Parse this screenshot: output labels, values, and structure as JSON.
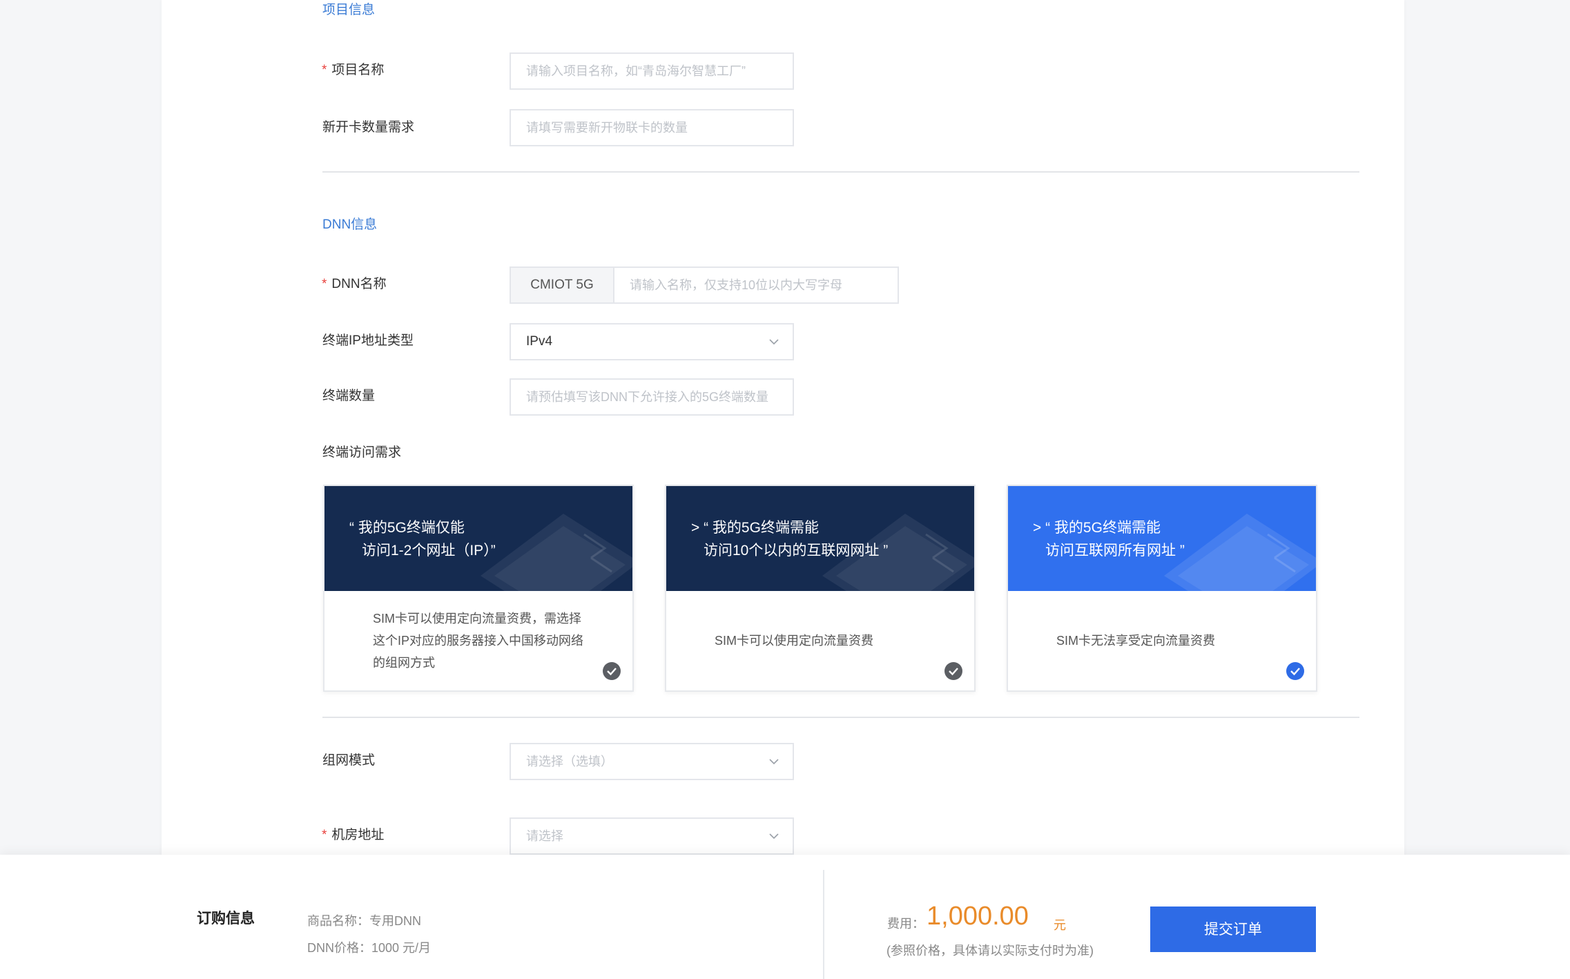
{
  "project_section": {
    "title": "项目信息",
    "required_mark": "*",
    "name_label": "项目名称",
    "name_placeholder": "请输入项目名称，如“青岛海尔智慧工厂”",
    "card_count_label": "新开卡数量需求",
    "card_count_placeholder": "请填写需要新开物联卡的数量"
  },
  "dnn_section": {
    "title": "DNN信息",
    "required_mark": "*",
    "dnn_name_label": "DNN名称",
    "dnn_prefix": "CMIOT 5G",
    "dnn_name_placeholder": "请输入名称，仅支持10位以内大写字母",
    "ip_type_label": "终端IP地址类型",
    "ip_type_value": "IPv4",
    "terminal_count_label": "终端数量",
    "terminal_count_placeholder": "请预估填写该DNN下允许接入的5G终端数量",
    "access_label": "终端访问需求",
    "access_options": [
      {
        "title_line1": "“ 我的5G终端仅能",
        "title_line2": "访问1-2个网址（IP）”",
        "desc_line1": "SIM卡可以使用定向流量资费，需选择",
        "desc_line2": "这个IP对应的服务器接入中国移动网络",
        "desc_line3": "的组网方式",
        "selected": false
      },
      {
        "title_line1": "> “ 我的5G终端需能",
        "title_line2": "访问10个以内的互联网网址 ”",
        "desc_line1": "SIM卡可以使用定向流量资费",
        "selected": false
      },
      {
        "title_line1": "> “ 我的5G终端需能",
        "title_line2": "访问互联网所有网址 ”",
        "desc_line1": "SIM卡无法享受定向流量资费",
        "selected": true
      }
    ],
    "network_mode_label": "组网模式",
    "network_mode_placeholder": "请选择（选填）",
    "room_label": "机房地址",
    "room_placeholder": "请选择"
  },
  "footer": {
    "title": "订购信息",
    "product_name": "商品名称：专用DNN",
    "dnn_price": "DNN价格：1000 元/月",
    "fee_label": "费用：",
    "fee_value": "1,000.00",
    "fee_unit": "元",
    "fee_note": "(参照价格，具体请以实际支付时为准)",
    "submit_label": "提交订单"
  },
  "colors": {
    "accent": "#2e6be6",
    "section_title": "#3a7bd5",
    "price": "#e98b2a",
    "required": "#e8423e",
    "card_dark": "#152b50",
    "card_selected": "#3070ee"
  }
}
